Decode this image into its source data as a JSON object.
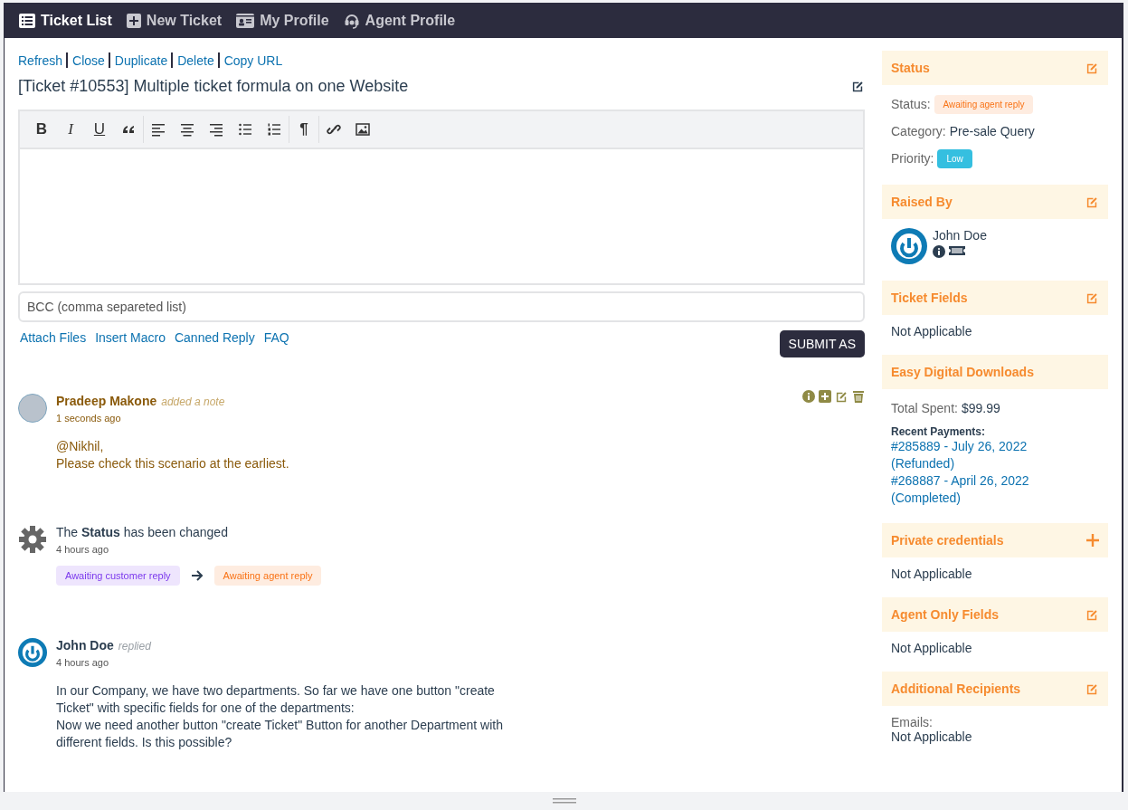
{
  "nav": {
    "items": [
      {
        "kind": "list",
        "label": "Ticket List",
        "selected": true
      },
      {
        "kind": "plus",
        "label": "New Ticket",
        "selected": false
      },
      {
        "kind": "card",
        "label": "My Profile",
        "selected": false
      },
      {
        "kind": "headset",
        "label": "Agent Profile",
        "selected": false
      }
    ]
  },
  "actions": [
    "Refresh",
    "Close",
    "Duplicate",
    "Delete",
    "Copy URL"
  ],
  "ticket_title": "[Ticket #10553] Multiple ticket formula on one Website",
  "editor": {
    "toolbar": [
      [
        {
          "kind": "bold",
          "text": "B"
        },
        {
          "kind": "italic",
          "text": "I"
        },
        {
          "kind": "underline",
          "text": "U"
        },
        {
          "kind": "quote"
        }
      ],
      [
        {
          "kind": "align-left"
        },
        {
          "kind": "align-center"
        },
        {
          "kind": "align-right"
        },
        {
          "kind": "bullet-list"
        },
        {
          "kind": "numbered-list"
        }
      ],
      [
        {
          "kind": "direction",
          "text": "¶"
        }
      ],
      [
        {
          "kind": "link"
        },
        {
          "kind": "image"
        }
      ]
    ],
    "bcc_placeholder": "BCC (comma separeted list)",
    "links": [
      "Attach Files",
      "Insert Macro",
      "Canned Reply",
      "FAQ"
    ],
    "submit": "SUBMIT AS"
  },
  "thread": [
    {
      "kind": "note",
      "author": "Pradeep Makone",
      "action": "added a note",
      "time": "1 seconds ago",
      "body": [
        "@Nikhil,",
        "Please check this scenario at the earliest."
      ]
    },
    {
      "kind": "status_change",
      "text": "The **Status** has been changed",
      "time": "4 hours ago",
      "from": {
        "label": "Awaiting customer reply",
        "color": "#7c3aed"
      },
      "to": {
        "label": "Awaiting agent reply",
        "color": "#f97316"
      }
    },
    {
      "kind": "reply",
      "author": "John Doe",
      "action": "replied",
      "time": "4 hours ago",
      "body": [
        "In our Company, we have two departments. So far we have one button \"create Ticket\" with specific fields for one of the departments:",
        "Now we need another button \"create Ticket\" Button for another Department with different fields. Is this possible?"
      ]
    }
  ],
  "sidebar": [
    {
      "kind": "status",
      "title": "Status",
      "edit_button": true,
      "rows": [
        {
          "label": "Status:",
          "value": "Awaiting agent reply",
          "kind": "badge",
          "color": "#f97316"
        },
        {
          "label": "Category:",
          "value": "Pre-sale Query",
          "kind": "text"
        },
        {
          "label": "Priority:",
          "value": "Low",
          "kind": "badge",
          "color": "#35bfe0"
        }
      ]
    },
    {
      "kind": "user",
      "title": "Raised By",
      "edit_button": true,
      "name": "John Doe"
    },
    {
      "kind": "text",
      "title": "Ticket Fields",
      "edit_button": true,
      "text": "Not Applicable"
    },
    {
      "kind": "edd",
      "title": "Easy Digital Downloads",
      "total_label": "Total Spent:",
      "total": "$99.99",
      "payments_label": "Recent Payments:",
      "payments": [
        "#285889 - July 26, 2022 (Refunded)",
        "#268887 - April 26, 2022 (Completed)"
      ]
    },
    {
      "kind": "text",
      "title": "Private credentials",
      "add_button": true,
      "text": "Not Applicable"
    },
    {
      "kind": "text",
      "title": "Agent Only Fields",
      "edit_button": true,
      "text": "Not Applicable"
    },
    {
      "kind": "labeled",
      "title": "Additional Recipients",
      "edit_button": true,
      "label": "Emails:",
      "text": "Not Applicable"
    }
  ]
}
